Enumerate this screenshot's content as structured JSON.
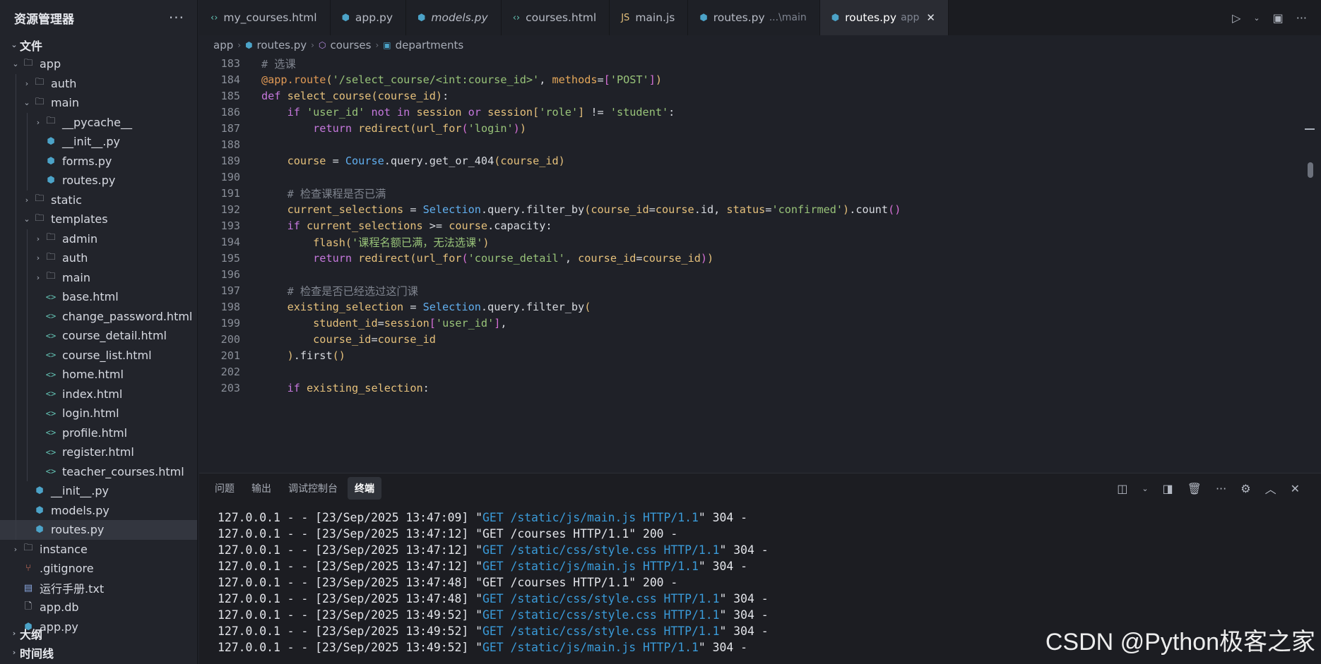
{
  "sidebar": {
    "title": "资源管理器",
    "more": "···",
    "sections": {
      "files": "文件",
      "outline": "大纲",
      "timeline": "时间线"
    },
    "tree": [
      {
        "label": "app",
        "type": "folder",
        "depth": 0,
        "open": true
      },
      {
        "label": "auth",
        "type": "folder",
        "depth": 1,
        "open": false
      },
      {
        "label": "main",
        "type": "folder",
        "depth": 1,
        "open": true
      },
      {
        "label": "__pycache__",
        "type": "folder",
        "depth": 2,
        "open": false
      },
      {
        "label": "__init__.py",
        "type": "py",
        "depth": 2
      },
      {
        "label": "forms.py",
        "type": "py",
        "depth": 2
      },
      {
        "label": "routes.py",
        "type": "py",
        "depth": 2
      },
      {
        "label": "static",
        "type": "folder",
        "depth": 1,
        "open": false
      },
      {
        "label": "templates",
        "type": "folder",
        "depth": 1,
        "open": true
      },
      {
        "label": "admin",
        "type": "folder",
        "depth": 2,
        "open": false
      },
      {
        "label": "auth",
        "type": "folder",
        "depth": 2,
        "open": false
      },
      {
        "label": "main",
        "type": "folder",
        "depth": 2,
        "open": false
      },
      {
        "label": "base.html",
        "type": "html",
        "depth": 2
      },
      {
        "label": "change_password.html",
        "type": "html",
        "depth": 2
      },
      {
        "label": "course_detail.html",
        "type": "html",
        "depth": 2
      },
      {
        "label": "course_list.html",
        "type": "html",
        "depth": 2
      },
      {
        "label": "home.html",
        "type": "html",
        "depth": 2
      },
      {
        "label": "index.html",
        "type": "html",
        "depth": 2
      },
      {
        "label": "login.html",
        "type": "html",
        "depth": 2
      },
      {
        "label": "profile.html",
        "type": "html",
        "depth": 2
      },
      {
        "label": "register.html",
        "type": "html",
        "depth": 2
      },
      {
        "label": "teacher_courses.html",
        "type": "html",
        "depth": 2
      },
      {
        "label": "__init__.py",
        "type": "py",
        "depth": 1
      },
      {
        "label": "models.py",
        "type": "py",
        "depth": 1
      },
      {
        "label": "routes.py",
        "type": "py",
        "depth": 1,
        "active": true
      },
      {
        "label": "instance",
        "type": "folder",
        "depth": 0,
        "open": false
      },
      {
        "label": ".gitignore",
        "type": "git",
        "depth": 0
      },
      {
        "label": "运行手册.txt",
        "type": "txt",
        "depth": 0
      },
      {
        "label": "app.db",
        "type": "db",
        "depth": 0
      },
      {
        "label": "app.py",
        "type": "py",
        "depth": 0
      }
    ]
  },
  "tabs": [
    {
      "label": "my_courses.html",
      "icon": "html",
      "italic": false
    },
    {
      "label": "app.py",
      "icon": "py",
      "italic": false
    },
    {
      "label": "models.py",
      "icon": "py",
      "italic": true
    },
    {
      "label": "courses.html",
      "icon": "html",
      "italic": false
    },
    {
      "label": "main.js",
      "icon": "js",
      "italic": false
    },
    {
      "label": "routes.py",
      "icon": "py",
      "sub": "...\\main",
      "italic": false
    },
    {
      "label": "routes.py",
      "icon": "py",
      "sub": "app",
      "italic": false,
      "active": true
    }
  ],
  "breadcrumb": {
    "root": "app",
    "file": "routes.py",
    "func": "courses",
    "var": "departments"
  },
  "editor": {
    "lines": [
      {
        "n": "183",
        "tokens": [
          [
            "cm",
            "# 选课"
          ]
        ]
      },
      {
        "n": "184",
        "tokens": [
          [
            "dec",
            "@app.route"
          ],
          [
            "br1",
            "("
          ],
          [
            "str",
            "'/select_course/<int:course_id>'"
          ],
          [
            "pl",
            ", "
          ],
          [
            "at",
            "methods"
          ],
          [
            "pl",
            "="
          ],
          [
            "br2",
            "["
          ],
          [
            "str",
            "'POST'"
          ],
          [
            "br2",
            "]"
          ],
          [
            "br1",
            ")"
          ]
        ]
      },
      {
        "n": "185",
        "tokens": [
          [
            "kw",
            "def "
          ],
          [
            "fn",
            "select_course"
          ],
          [
            "br1",
            "("
          ],
          [
            "var",
            "course_id"
          ],
          [
            "br1",
            ")"
          ],
          [
            "pl",
            ":"
          ]
        ]
      },
      {
        "n": "186",
        "tokens": [
          [
            "ind",
            "    "
          ],
          [
            "kw",
            "if "
          ],
          [
            "str",
            "'user_id'"
          ],
          [
            "kw",
            " not in "
          ],
          [
            "var",
            "session"
          ],
          [
            "kw",
            " or "
          ],
          [
            "var",
            "session"
          ],
          [
            "br1",
            "["
          ],
          [
            "str",
            "'role'"
          ],
          [
            "br1",
            "]"
          ],
          [
            "pl",
            " != "
          ],
          [
            "str",
            "'student'"
          ],
          [
            "pl",
            ":"
          ]
        ]
      },
      {
        "n": "187",
        "tokens": [
          [
            "ind",
            "        "
          ],
          [
            "kw",
            "return "
          ],
          [
            "fn",
            "redirect"
          ],
          [
            "br1",
            "("
          ],
          [
            "fn",
            "url_for"
          ],
          [
            "br2",
            "("
          ],
          [
            "str",
            "'login'"
          ],
          [
            "br2",
            ")"
          ],
          [
            "br1",
            ")"
          ]
        ]
      },
      {
        "n": "188",
        "tokens": []
      },
      {
        "n": "189",
        "tokens": [
          [
            "ind",
            "    "
          ],
          [
            "var",
            "course"
          ],
          [
            "pl",
            " = "
          ],
          [
            "cls",
            "Course"
          ],
          [
            "pl",
            ".query.get_or_404"
          ],
          [
            "br1",
            "("
          ],
          [
            "var",
            "course_id"
          ],
          [
            "br1",
            ")"
          ]
        ]
      },
      {
        "n": "190",
        "tokens": []
      },
      {
        "n": "191",
        "tokens": [
          [
            "ind",
            "    "
          ],
          [
            "cm",
            "# 检查课程是否已满"
          ]
        ]
      },
      {
        "n": "192",
        "tokens": [
          [
            "ind",
            "    "
          ],
          [
            "var",
            "current_selections"
          ],
          [
            "pl",
            " = "
          ],
          [
            "cls",
            "Selection"
          ],
          [
            "pl",
            ".query.filter_by"
          ],
          [
            "br1",
            "("
          ],
          [
            "var",
            "course_id"
          ],
          [
            "pl",
            "="
          ],
          [
            "var",
            "course"
          ],
          [
            "pl",
            ".id, "
          ],
          [
            "var",
            "status"
          ],
          [
            "pl",
            "="
          ],
          [
            "str",
            "'confirmed'"
          ],
          [
            "br1",
            ")"
          ],
          [
            "pl",
            ".count"
          ],
          [
            "br2",
            "("
          ],
          [
            "br2",
            ")"
          ]
        ]
      },
      {
        "n": "193",
        "tokens": [
          [
            "ind",
            "    "
          ],
          [
            "kw",
            "if "
          ],
          [
            "var",
            "current_selections"
          ],
          [
            "pl",
            " >= "
          ],
          [
            "var",
            "course"
          ],
          [
            "pl",
            ".capacity:"
          ]
        ]
      },
      {
        "n": "194",
        "tokens": [
          [
            "ind",
            "        "
          ],
          [
            "fn",
            "flash"
          ],
          [
            "br1",
            "("
          ],
          [
            "str",
            "'课程名额已满，无法选课'"
          ],
          [
            "br1",
            ")"
          ]
        ]
      },
      {
        "n": "195",
        "tokens": [
          [
            "ind",
            "        "
          ],
          [
            "kw",
            "return "
          ],
          [
            "fn",
            "redirect"
          ],
          [
            "br1",
            "("
          ],
          [
            "fn",
            "url_for"
          ],
          [
            "br2",
            "("
          ],
          [
            "str",
            "'course_detail'"
          ],
          [
            "pl",
            ", "
          ],
          [
            "var",
            "course_id"
          ],
          [
            "pl",
            "="
          ],
          [
            "var",
            "course_id"
          ],
          [
            "br2",
            ")"
          ],
          [
            "br1",
            ")"
          ]
        ]
      },
      {
        "n": "196",
        "tokens": []
      },
      {
        "n": "197",
        "tokens": [
          [
            "ind",
            "    "
          ],
          [
            "cm",
            "# 检查是否已经选过这门课"
          ]
        ]
      },
      {
        "n": "198",
        "tokens": [
          [
            "ind",
            "    "
          ],
          [
            "var",
            "existing_selection"
          ],
          [
            "pl",
            " = "
          ],
          [
            "cls",
            "Selection"
          ],
          [
            "pl",
            ".query.filter_by"
          ],
          [
            "br1",
            "("
          ]
        ]
      },
      {
        "n": "199",
        "tokens": [
          [
            "ind",
            "        "
          ],
          [
            "var",
            "student_id"
          ],
          [
            "pl",
            "="
          ],
          [
            "var",
            "session"
          ],
          [
            "br2",
            "["
          ],
          [
            "str",
            "'user_id'"
          ],
          [
            "br2",
            "]"
          ],
          [
            "pl",
            ","
          ]
        ]
      },
      {
        "n": "200",
        "tokens": [
          [
            "ind",
            "        "
          ],
          [
            "var",
            "course_id"
          ],
          [
            "pl",
            "="
          ],
          [
            "var",
            "course_id"
          ]
        ]
      },
      {
        "n": "201",
        "tokens": [
          [
            "ind",
            "    "
          ],
          [
            "br1",
            ")"
          ],
          [
            "pl",
            ".first"
          ],
          [
            "br1",
            "("
          ],
          [
            "br1",
            ")"
          ]
        ]
      },
      {
        "n": "202",
        "tokens": []
      },
      {
        "n": "203",
        "tokens": [
          [
            "ind",
            "    "
          ],
          [
            "kw",
            "if "
          ],
          [
            "var",
            "existing_selection"
          ],
          [
            "pl",
            ":"
          ]
        ]
      }
    ]
  },
  "panel": {
    "tabs": [
      {
        "label": "问题"
      },
      {
        "label": "输出"
      },
      {
        "label": "调试控制台"
      },
      {
        "label": "终端",
        "active": true
      }
    ],
    "terminal": [
      {
        "pre": "127.0.0.1 - - [23/Sep/2025 13:47:09] \"",
        "blue": "GET /static/js/main.js HTTP/1.1",
        "post": "\" 304 -"
      },
      {
        "pre": "127.0.0.1 - - [23/Sep/2025 13:47:12] \"GET /courses HTTP/1.1\" 200 -",
        "blue": "",
        "post": ""
      },
      {
        "pre": "127.0.0.1 - - [23/Sep/2025 13:47:12] \"",
        "blue": "GET /static/css/style.css HTTP/1.1",
        "post": "\" 304 -"
      },
      {
        "pre": "127.0.0.1 - - [23/Sep/2025 13:47:12] \"",
        "blue": "GET /static/js/main.js HTTP/1.1",
        "post": "\" 304 -"
      },
      {
        "pre": "127.0.0.1 - - [23/Sep/2025 13:47:48] \"GET /courses HTTP/1.1\" 200 -",
        "blue": "",
        "post": ""
      },
      {
        "pre": "127.0.0.1 - - [23/Sep/2025 13:47:48] \"",
        "blue": "GET /static/css/style.css HTTP/1.1",
        "post": "\" 304 -"
      },
      {
        "pre": "127.0.0.1 - - [23/Sep/2025 13:49:52] \"",
        "blue": "GET /static/css/style.css HTTP/1.1",
        "post": "\" 304 -"
      },
      {
        "pre": "127.0.0.1 - - [23/Sep/2025 13:49:52] \"",
        "blue": "GET /static/css/style.css HTTP/1.1",
        "post": "\" 304 -"
      },
      {
        "pre": "127.0.0.1 - - [23/Sep/2025 13:49:52] \"",
        "blue": "GET /static/js/main.js HTTP/1.1",
        "post": "\" 304 -"
      }
    ]
  },
  "watermark": "CSDN @Python极客之家"
}
